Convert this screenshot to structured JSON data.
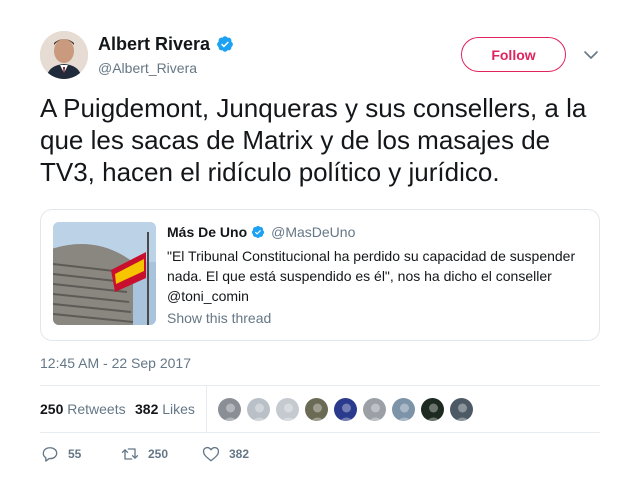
{
  "author": {
    "display_name": "Albert Rivera",
    "handle": "@Albert_Rivera",
    "verified": true
  },
  "follow_button": {
    "label": "Follow"
  },
  "tweet": {
    "text": "A Puigdemont, Junqueras y sus consellers, a la que les sacas de Matrix y de los masajes de TV3, hacen el ridículo político y jurídico."
  },
  "quoted_tweet": {
    "display_name": "Más De Uno",
    "handle": "@MasDeUno",
    "verified": true,
    "text": "\"El Tribunal Constitucional ha perdido su capacidad de suspender nada. El que está suspendido es él\", nos ha dicho el conseller @toni_comin",
    "thread_link": "Show this thread"
  },
  "timestamp": "12:45 AM - 22 Sep 2017",
  "stats": {
    "retweets_count": "250",
    "retweets_label": "Retweets",
    "likes_count": "382",
    "likes_label": "Likes"
  },
  "liker_avatars": [
    "#8a8f95",
    "#b9c0c7",
    "#c4cad0",
    "#6b6a55",
    "#2a3a8c",
    "#9aa0a6",
    "#7c93a8",
    "#1d2a1f",
    "#4d5a66"
  ],
  "actions": {
    "reply_count": "55",
    "retweet_count": "250",
    "like_count": "382"
  },
  "colors": {
    "accent": "#e0245e",
    "verified": "#1da1f2",
    "muted": "#657786"
  }
}
